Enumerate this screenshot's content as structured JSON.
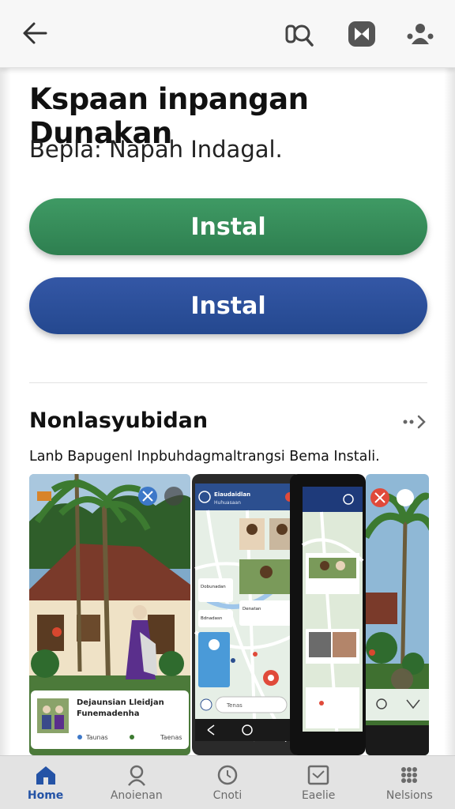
{
  "topbar": {
    "back_icon": "arrow-left-icon",
    "actions": [
      "search-icon",
      "app-icon",
      "account-icon"
    ]
  },
  "app": {
    "title": "Kspaan inpangan Dunakan",
    "subtitle": "Bepla: Napah Indagal."
  },
  "buttons": {
    "primary_install": "Instal",
    "secondary_install": "Instal"
  },
  "section": {
    "title": "Nonlasyubidan",
    "description": "Lanb Bapugenl Inpbuhdagmaltrangsi Bema Instali.",
    "more_icon": "arrow-right-icon"
  },
  "screenshots": {
    "card1_title": "Dejaunsian Lleidjan",
    "card1_subtitle": "Funemadenha",
    "card1_foot_left": "Taunas",
    "card1_foot_right": "Taenas",
    "phone_header": "Eiaudaidlan",
    "phone_header_sub": "Huhuasaan",
    "map_label1": "Dobunadan",
    "map_label2": "Bdnadasn",
    "map_label3": "Denatan",
    "search_chip": "Tenas"
  },
  "nav": {
    "items": [
      {
        "label": "Home",
        "icon": "home-icon",
        "active": true
      },
      {
        "label": "Anoienan",
        "icon": "person-icon",
        "active": false
      },
      {
        "label": "Cnoti",
        "icon": "clock-icon",
        "active": false
      },
      {
        "label": "Eaelie",
        "icon": "image-icon",
        "active": false
      },
      {
        "label": "Nelsions",
        "icon": "grid-icon",
        "active": false
      }
    ]
  },
  "colors": {
    "green_button": "#2e7f50",
    "blue_button": "#24488f",
    "nav_active": "#2453a6"
  }
}
